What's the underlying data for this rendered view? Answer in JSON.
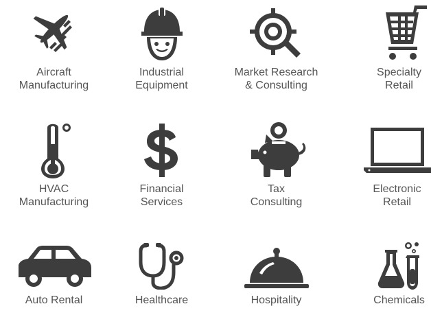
{
  "colors": {
    "icon": "#3d3d3d",
    "text": "#555555",
    "background": "#ffffff"
  },
  "industries": [
    {
      "label": "Aircraft\nManufacturing",
      "icon": "airplane-icon"
    },
    {
      "label": "Industrial\nEquipment",
      "icon": "worker-hardhat-icon"
    },
    {
      "label": "Market Research\n& Consulting",
      "icon": "target-magnifier-icon"
    },
    {
      "label": "Specialty\nRetail",
      "icon": "shopping-cart-icon"
    },
    {
      "label": "HVAC\nManufacturing",
      "icon": "thermometer-icon"
    },
    {
      "label": "Financial\nServices",
      "icon": "dollar-sign-icon"
    },
    {
      "label": "Tax\nConsulting",
      "icon": "piggy-bank-icon"
    },
    {
      "label": "Electronic\nRetail",
      "icon": "laptop-icon"
    },
    {
      "label": "Auto Rental",
      "icon": "car-icon"
    },
    {
      "label": "Healthcare",
      "icon": "stethoscope-icon"
    },
    {
      "label": "Hospitality",
      "icon": "cloche-icon"
    },
    {
      "label": "Chemicals",
      "icon": "lab-flasks-icon"
    }
  ]
}
